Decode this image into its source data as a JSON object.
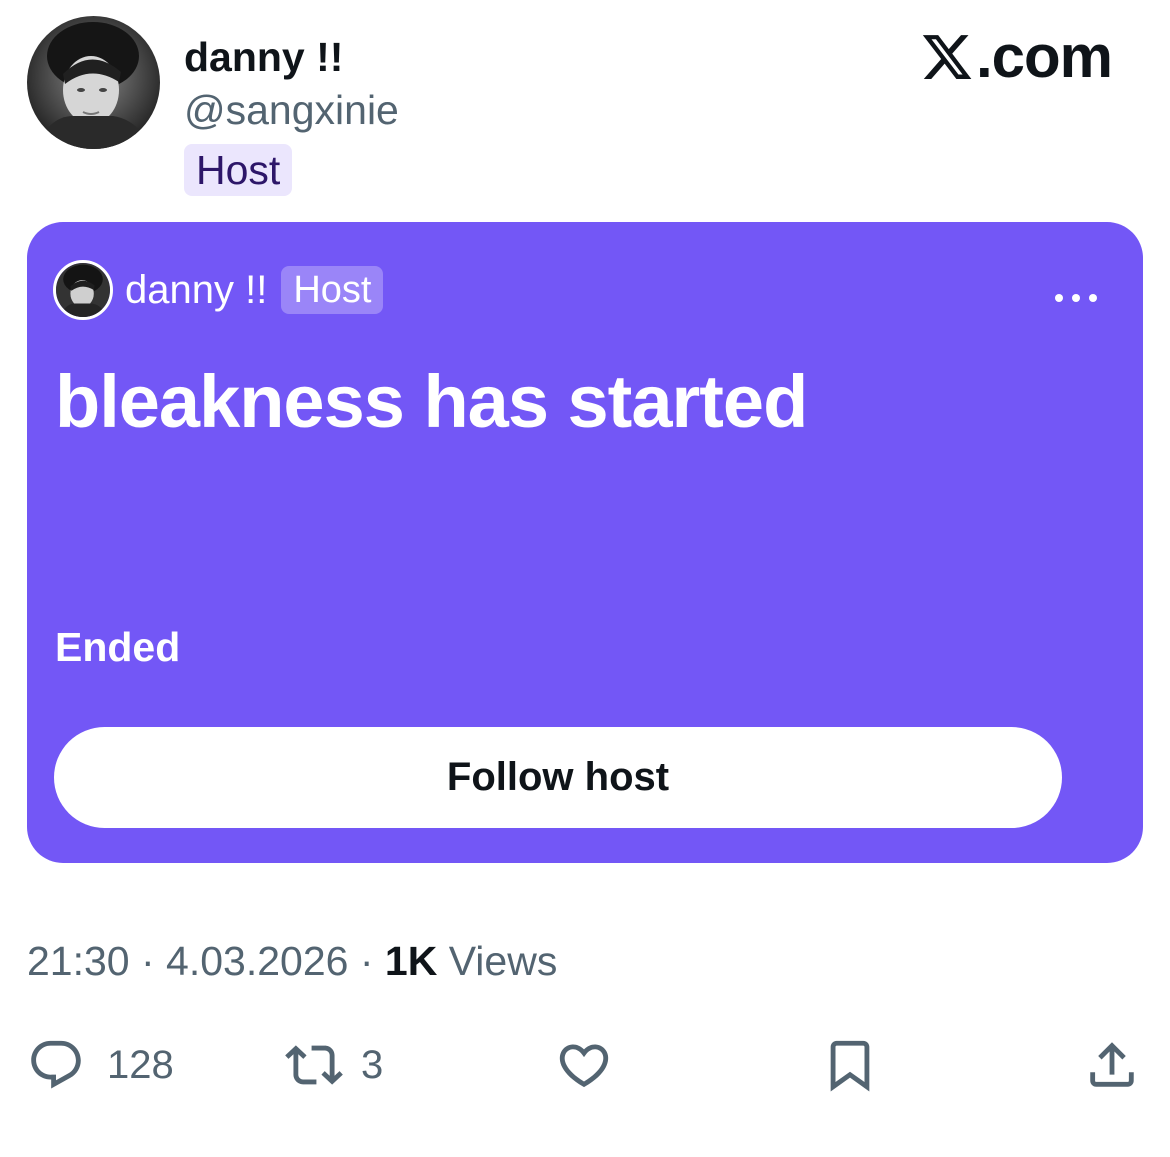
{
  "author": {
    "display_name": "danny !!",
    "handle": "@sangxinie",
    "role_badge": "Host"
  },
  "brand": {
    "label": ".com",
    "icon": "x-logo-icon"
  },
  "space": {
    "host_name": "danny !!",
    "host_badge": "Host",
    "title": "bleakness has started",
    "status": "Ended",
    "follow_label": "Follow host",
    "card_color": "#7357f6"
  },
  "meta": {
    "time": "21:30",
    "separator": " · ",
    "date": "4.03.2026",
    "views_count": "1K",
    "views_label": " Views"
  },
  "actions": {
    "reply_count": "128",
    "repost_count": "3",
    "icons": [
      "reply-icon",
      "repost-icon",
      "like-icon",
      "bookmark-icon",
      "share-icon"
    ]
  }
}
